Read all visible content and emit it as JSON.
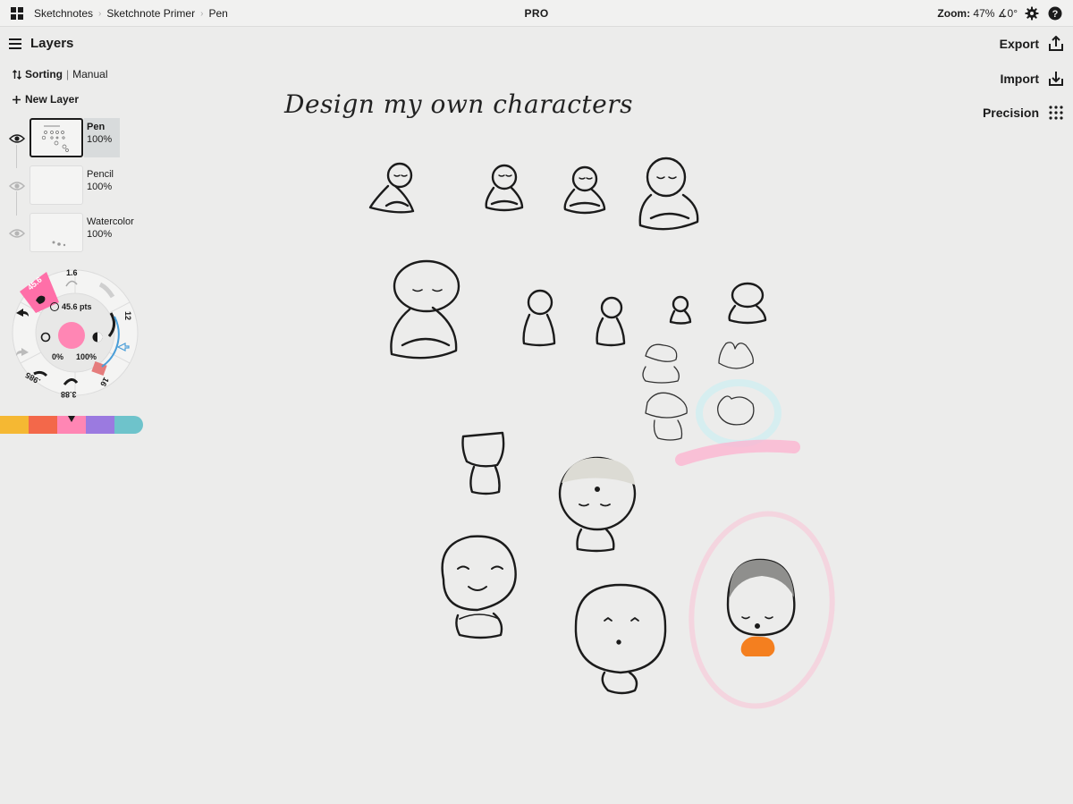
{
  "topbar": {
    "breadcrumbs": [
      "Sketchnotes",
      "Sketchnote Primer",
      "Pen"
    ],
    "badge": "PRO",
    "zoom_label": "Zoom:",
    "zoom_value": "47% ∡0°"
  },
  "layers": {
    "title": "Layers",
    "sorting_label": "Sorting",
    "sorting_value": "Manual",
    "new_layer_label": "New Layer",
    "items": [
      {
        "name": "Pen",
        "opacity": "100%",
        "visible": true,
        "active": true
      },
      {
        "name": "Pencil",
        "opacity": "100%",
        "visible": false,
        "active": false
      },
      {
        "name": "Watercolor",
        "opacity": "100%",
        "visible": false,
        "active": false
      }
    ]
  },
  "tool_wheel": {
    "size_readout": "45.6 pts",
    "opacity_min": "0%",
    "opacity_max": "100%",
    "preset_sizes": [
      "1.6",
      "45.6",
      "12",
      "16",
      "3.88",
      ".985"
    ],
    "current_color": "#ff86b4"
  },
  "palette": {
    "colors": [
      "#f5b833",
      "#f3684a",
      "#ff86b4",
      "#9b7ae0",
      "#6ec3cb"
    ],
    "selected_index": 2
  },
  "right_panel": {
    "export_label": "Export",
    "import_label": "Import",
    "precision_label": "Precision"
  },
  "canvas": {
    "heading": "Design my own characters"
  }
}
